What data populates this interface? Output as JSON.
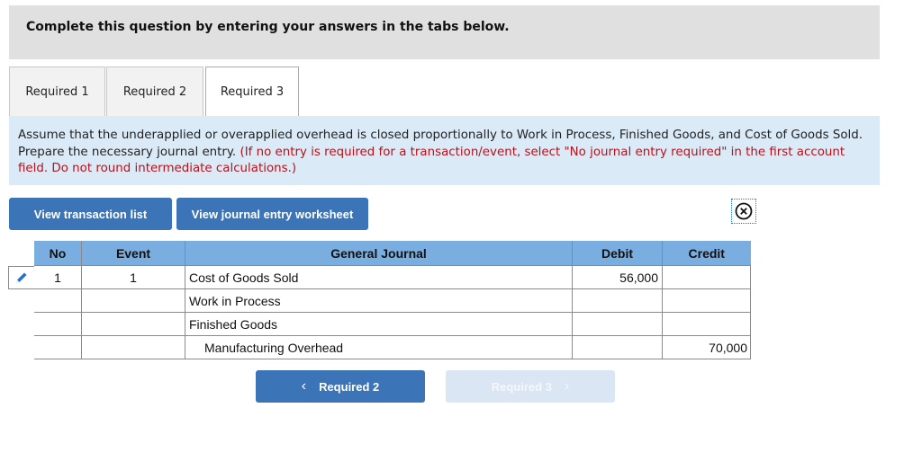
{
  "header": {
    "text": "Complete this question by entering your answers in the tabs below."
  },
  "tabs": [
    {
      "label": "Required 1",
      "active": false
    },
    {
      "label": "Required 2",
      "active": false
    },
    {
      "label": "Required 3",
      "active": true
    }
  ],
  "instructions": {
    "main": "Assume that the underapplied or overapplied overhead is closed proportionally to Work in Process, Finished Goods, and Cost of Goods Sold. Prepare the necessary journal entry.",
    "note": "(If no entry is required for a transaction/event, select \"No journal entry required\" in the first account field. Do not round intermediate calculations.)"
  },
  "toolbar": {
    "view_transaction_list": "View transaction list",
    "view_journal_entry_worksheet": "View journal entry worksheet",
    "close_icon": "circle-x-icon"
  },
  "journal": {
    "columns": [
      "No",
      "Event",
      "General Journal",
      "Debit",
      "Credit"
    ],
    "rows": [
      {
        "no": "1",
        "event": "1",
        "account": "Cost of Goods Sold",
        "debit": "56,000",
        "credit": "",
        "indent": false
      },
      {
        "no": "",
        "event": "",
        "account": "Work in Process",
        "debit": "",
        "credit": "",
        "indent": false
      },
      {
        "no": "",
        "event": "",
        "account": "Finished Goods",
        "debit": "",
        "credit": "",
        "indent": false
      },
      {
        "no": "",
        "event": "",
        "account": "Manufacturing Overhead",
        "debit": "",
        "credit": "70,000",
        "indent": true
      }
    ]
  },
  "nav": {
    "prev_label": "Required 2",
    "next_label": "Required 3",
    "prev_icon": "chevron-left-icon",
    "next_icon": "chevron-right-icon"
  },
  "colors": {
    "primary_button": "#3b74b7",
    "disabled_button": "#dbe6f4",
    "table_header": "#7aaee0",
    "instruction_bg": "#dbeaf7",
    "note_red": "#b5121b"
  }
}
